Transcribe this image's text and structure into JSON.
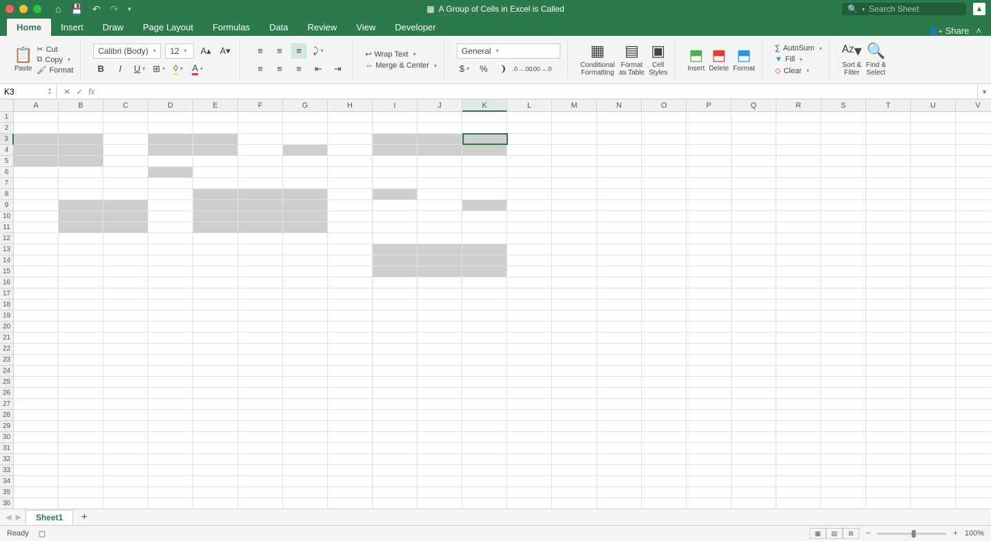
{
  "title": "A Group of Cells in Excel is Called",
  "search_placeholder": "Search Sheet",
  "tabs": [
    "Home",
    "Insert",
    "Draw",
    "Page Layout",
    "Formulas",
    "Data",
    "Review",
    "View",
    "Developer"
  ],
  "share": "Share",
  "clipboard": {
    "paste": "Paste",
    "cut": "Cut",
    "copy": "Copy",
    "format": "Format"
  },
  "font": {
    "name": "Calibri (Body)",
    "size": "12"
  },
  "wrap": "Wrap Text",
  "merge": "Merge & Center",
  "number_format": "General",
  "cond_fmt": "Conditional\nFormatting",
  "fmt_table": "Format\nas Table",
  "cell_styles": "Cell\nStyles",
  "insert": "Insert",
  "delete": "Delete",
  "format": "Format",
  "autosum": "AutoSum",
  "fill": "Fill",
  "clear": "Clear",
  "sort": "Sort &\nFilter",
  "find": "Find &\nSelect",
  "namebox": "K3",
  "fx": "fx",
  "columns": [
    "A",
    "B",
    "C",
    "D",
    "E",
    "F",
    "G",
    "H",
    "I",
    "J",
    "K",
    "L",
    "M",
    "N",
    "O",
    "P",
    "Q",
    "R",
    "S",
    "T",
    "U",
    "V"
  ],
  "rows": 36,
  "shaded_cells": [
    [
      3,
      "A"
    ],
    [
      3,
      "B"
    ],
    [
      4,
      "A"
    ],
    [
      4,
      "B"
    ],
    [
      5,
      "A"
    ],
    [
      5,
      "B"
    ],
    [
      3,
      "D"
    ],
    [
      3,
      "E"
    ],
    [
      4,
      "D"
    ],
    [
      4,
      "E"
    ],
    [
      6,
      "D"
    ],
    [
      4,
      "G"
    ],
    [
      3,
      "I"
    ],
    [
      3,
      "J"
    ],
    [
      3,
      "K"
    ],
    [
      4,
      "I"
    ],
    [
      4,
      "J"
    ],
    [
      4,
      "K"
    ],
    [
      9,
      "B"
    ],
    [
      9,
      "C"
    ],
    [
      10,
      "B"
    ],
    [
      10,
      "C"
    ],
    [
      11,
      "B"
    ],
    [
      11,
      "C"
    ],
    [
      8,
      "E"
    ],
    [
      8,
      "F"
    ],
    [
      8,
      "G"
    ],
    [
      9,
      "E"
    ],
    [
      9,
      "F"
    ],
    [
      9,
      "G"
    ],
    [
      10,
      "E"
    ],
    [
      10,
      "F"
    ],
    [
      10,
      "G"
    ],
    [
      11,
      "E"
    ],
    [
      11,
      "F"
    ],
    [
      11,
      "G"
    ],
    [
      8,
      "I"
    ],
    [
      9,
      "K"
    ],
    [
      13,
      "I"
    ],
    [
      13,
      "J"
    ],
    [
      13,
      "K"
    ],
    [
      14,
      "I"
    ],
    [
      14,
      "J"
    ],
    [
      14,
      "K"
    ],
    [
      15,
      "I"
    ],
    [
      15,
      "J"
    ],
    [
      15,
      "K"
    ]
  ],
  "active_cell": [
    3,
    "K"
  ],
  "sheet": "Sheet1",
  "status": "Ready",
  "zoom": "100%"
}
